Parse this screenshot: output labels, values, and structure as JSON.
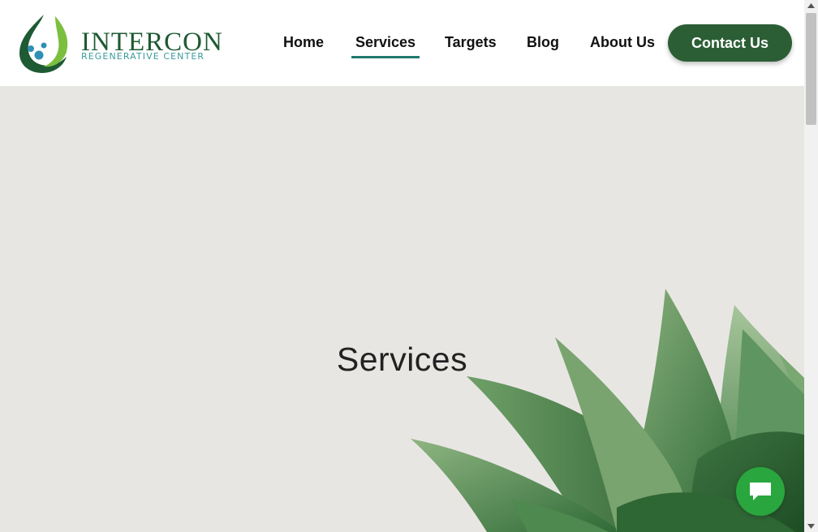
{
  "brand": {
    "name": "INTERCON",
    "subtitle": "REGENERATIVE CENTER",
    "primary_color": "#1e5a33",
    "accent_color": "#3a9a9c"
  },
  "nav": {
    "items": [
      {
        "label": "Home",
        "active": false
      },
      {
        "label": "Services",
        "active": true
      },
      {
        "label": "Targets",
        "active": false
      },
      {
        "label": "Blog",
        "active": false
      },
      {
        "label": "About Us",
        "active": false
      }
    ],
    "contact_label": "Contact Us",
    "contact_color": "#2c5e35",
    "active_underline_color": "#1f7a6e"
  },
  "hero": {
    "title": "Services",
    "background_color": "#e8e6e3",
    "image": "succulent-plant"
  },
  "chat": {
    "icon": "chat-bubble-icon",
    "color": "#2aa63e"
  }
}
